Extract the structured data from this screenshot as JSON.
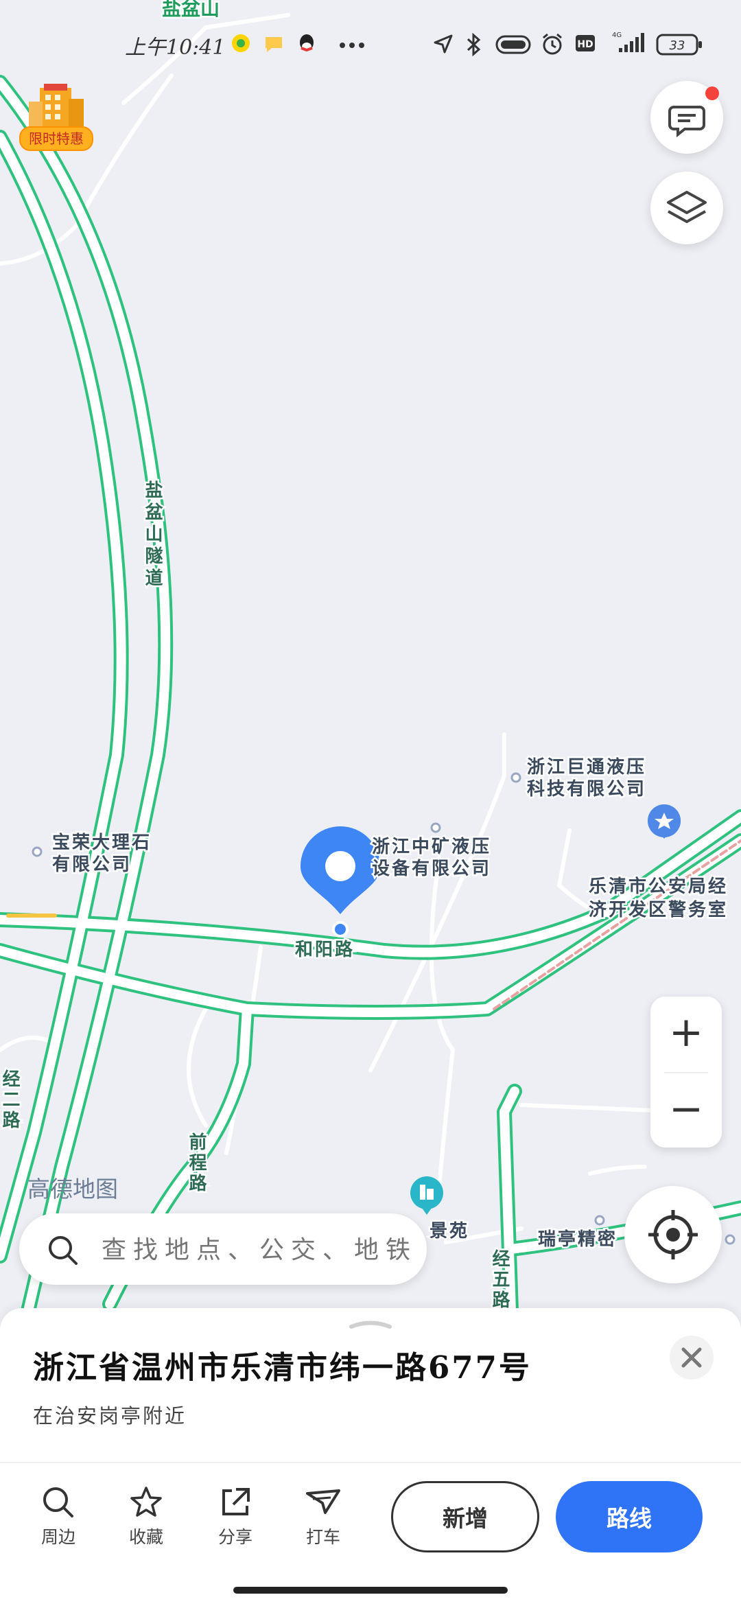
{
  "status_bar": {
    "time": "上午10:41",
    "signal": "4G",
    "battery": "33",
    "hd": "HD",
    "icons": [
      "music-icon",
      "message-icon",
      "qq-icon",
      "more-icon",
      "location-arrow-icon",
      "bluetooth-icon",
      "toggle-icon",
      "alarm-icon",
      "hd-icon",
      "signal-icon",
      "battery-icon"
    ]
  },
  "promo": {
    "label": "限时特惠",
    "icon": "hotel-icon"
  },
  "map": {
    "labels": {
      "mountain": "盐盆山",
      "tunnel": "盐盆山隧道",
      "road_heyang": "和阳路",
      "road_jing2": "经二路",
      "road_jing5": "经五路",
      "road_qianlu": "前程路",
      "poi_jutong_1": "浙江巨通液压",
      "poi_jutong_2": "科技有限公司",
      "poi_zhongkuang_1": "浙江中矿液压",
      "poi_zhongkuang_2": "设备有限公司",
      "poi_baorong_1": "宝荣大理石",
      "poi_baorong_2": "有限公司",
      "poi_police_1": "乐清市公安局经",
      "poi_police_2": "济开发区警务室",
      "poi_jingyuan": "景苑",
      "poi_ruiting": "瑞亭精密"
    },
    "colors": {
      "road_green": "#2ec27e",
      "background": "#edeff5",
      "pin": "#3f86f5",
      "police": "#4f88e6",
      "building": "#29b6c9"
    },
    "logo": "高德地图"
  },
  "controls": {
    "zoom_in": "+",
    "zoom_out": "−",
    "message_icon": "chat-icon",
    "layers_icon": "layers-icon",
    "locate_icon": "locate-icon"
  },
  "search": {
    "placeholder": "查找地点、公交、地铁"
  },
  "sheet": {
    "address": "浙江省温州市乐清市纬一路677号",
    "nearby": "在治安岗亭附近",
    "actions": [
      {
        "label": "周边",
        "icon": "search-icon"
      },
      {
        "label": "收藏",
        "icon": "star-icon"
      },
      {
        "label": "分享",
        "icon": "share-icon"
      },
      {
        "label": "打车",
        "icon": "taxi-icon"
      }
    ],
    "add_label": "新增",
    "route_label": "路线"
  }
}
